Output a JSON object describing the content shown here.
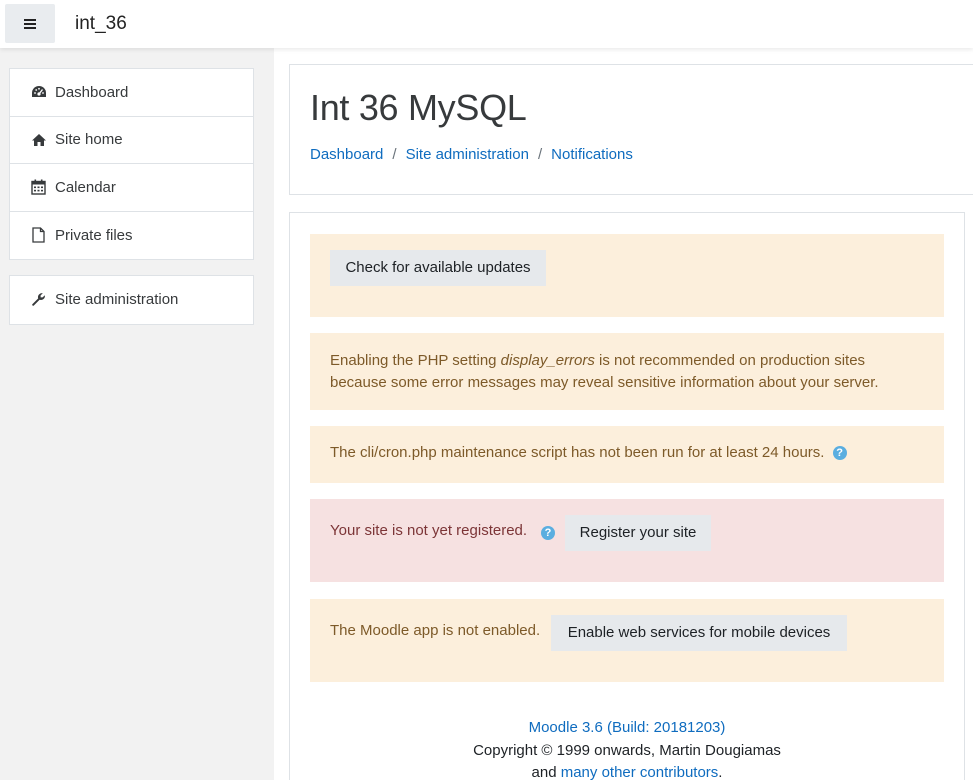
{
  "navbar": {
    "site_name": "int_36"
  },
  "drawer": {
    "nav_items": [
      {
        "label": "Dashboard",
        "icon": "dashboard-icon"
      },
      {
        "label": "Site home",
        "icon": "home-icon"
      },
      {
        "label": "Calendar",
        "icon": "calendar-icon"
      },
      {
        "label": "Private files",
        "icon": "file-icon"
      }
    ],
    "admin_item": {
      "label": "Site administration",
      "icon": "wrench-icon"
    }
  },
  "header": {
    "title": "Int 36 MySQL",
    "breadcrumb": [
      "Dashboard",
      "Site administration",
      "Notifications"
    ],
    "separator": "/"
  },
  "notifications": {
    "check_updates_button": "Check for available updates",
    "display_errors": {
      "before": "Enabling the PHP setting ",
      "setting": "display_errors",
      "after": " is not recommended on production sites because some error messages may reveal sensitive information about your server."
    },
    "cron_message": "The cli/cron.php maintenance script has not been run for at least 24 hours.",
    "registration_message": "Your site is not yet registered.",
    "register_button": "Register your site",
    "app_message": "The Moodle app is not enabled.",
    "enable_ws_button": "Enable web services for mobile devices"
  },
  "footer": {
    "version_link": "Moodle 3.6 (Build: 20181203)",
    "copyright": "Copyright © 1999 onwards, Martin Dougiamas",
    "and_text": "and ",
    "contributors_link": "many other contributors",
    "period": "."
  },
  "colors": {
    "link": "#0f6cbf",
    "warning_bg": "#fcefdc",
    "danger_bg": "#f6e1e1",
    "help_icon": "#5aaee0"
  }
}
